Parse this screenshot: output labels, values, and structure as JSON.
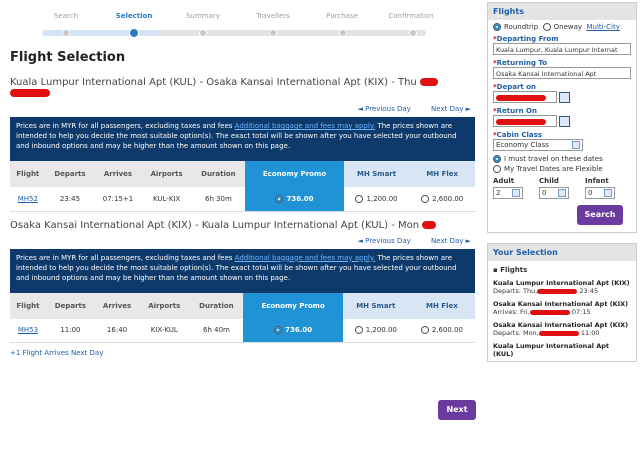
{
  "steps": [
    {
      "label": "Search",
      "active": false
    },
    {
      "label": "Selection",
      "active": true
    },
    {
      "label": "Summary",
      "active": false
    },
    {
      "label": "Travellers",
      "active": false
    },
    {
      "label": "Purchase",
      "active": false
    },
    {
      "label": "Confirmation",
      "active": false
    }
  ],
  "page_title": "Flight Selection",
  "outbound": {
    "route": "Kuala Lumpur International Apt (KUL) - Osaka Kansai International Apt (KIX) - Thu",
    "flight": "MH52",
    "departs": "23:45",
    "arrives": "07:15+1",
    "airports": "KUL-KIX",
    "duration": "6h 30m",
    "economy_promo": "736.00",
    "mh_smart": "1,200.00",
    "mh_flex": "2,600.00"
  },
  "inbound": {
    "route": "Osaka Kansai International Apt (KIX) - Kuala Lumpur International Apt (KUL) - Mon",
    "flight": "MH53",
    "departs": "11:00",
    "arrives": "16:40",
    "airports": "KIX-KUL",
    "duration": "6h 40m",
    "economy_promo": "736.00",
    "mh_smart": "1,200.00",
    "mh_flex": "2,600.00"
  },
  "daynav": {
    "prev": "◄ Previous Day",
    "next": "Next Day ►"
  },
  "notice": {
    "part1": "Prices are in MYR for all passengers, excluding taxes and fees ",
    "link": "Additional baggage and fees may apply.",
    "part2": " The prices shown are intended to help you decide the most suitable option(s). The exact total will be shown after you have selected your outbound and inbound options and may be higher than the amount shown on this page."
  },
  "columns": {
    "flight": "Flight",
    "departs": "Departs",
    "arrives": "Arrives",
    "airports": "Airports",
    "duration": "Duration",
    "economy": "Economy Promo",
    "smart": "MH Smart",
    "flex": "MH Flex"
  },
  "arrive_note": "+1   Flight Arrives Next Day",
  "next_label": "Next",
  "sidebar": {
    "flights_title": "Flights",
    "roundtrip": "Roundtrip",
    "oneway": "Oneway",
    "multicity": "Multi-City",
    "departing_label": "Departing From",
    "departing_value": "Kuala Lumpur, Kuala Lumpur Internat",
    "returning_label": "Returning To",
    "returning_value": "Osaka Kansai International Apt",
    "depart_on": "Depart on",
    "return_on": "Return On",
    "cabin_label": "Cabin Class",
    "cabin_value": "Economy Class",
    "must_travel": "I must travel on these dates",
    "flexible": "My Travel Dates are Flexible",
    "adult": "Adult",
    "child": "Child",
    "infant": "Infant",
    "adult_val": "2",
    "child_val": "0",
    "infant_val": "0",
    "search": "Search",
    "your_selection": "Your Selection",
    "flights_sub": "Flights",
    "sel1_title": "Kuala Lumpur International Apt (KIX)",
    "sel1_line": "Departs: Thu,",
    "sel1_time": "23:45",
    "sel2_title": "Osaka Kansai International Apt (KIX)",
    "sel2_line": "Arrives: Fri,",
    "sel2_time": "07:15",
    "sel3_title": "Osaka Kansai International Apt (KIX)",
    "sel3_line": "Departs: Mon,",
    "sel3_time": "11:00",
    "sel4_title": "Kuala Lumpur International Apt (KUL)"
  }
}
